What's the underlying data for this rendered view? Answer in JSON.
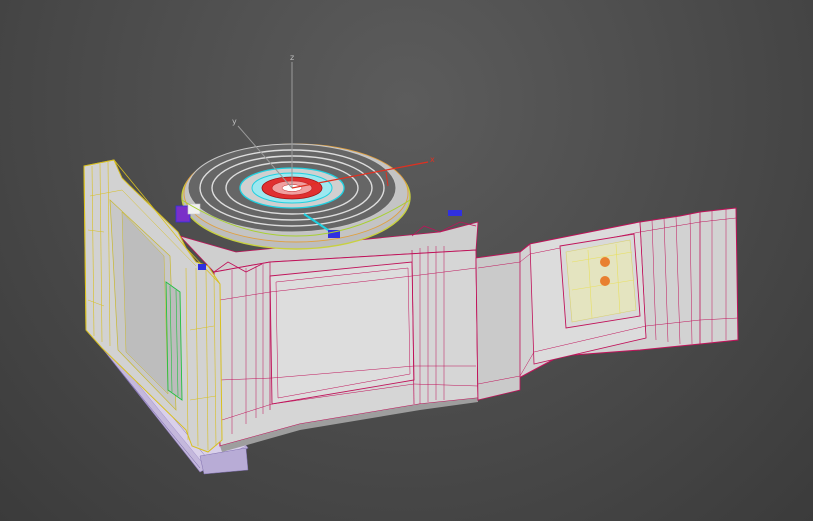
{
  "viewport": {
    "background": "#484848",
    "wire_colors": {
      "main_body": "#c0135a",
      "frame": "#d8c020",
      "ring": "#c8d040",
      "inner_ring": "#20d0e0",
      "center": "#e03030",
      "gizmo_x": "#e03020",
      "gizmo_y": "#9a9a9a",
      "gizmo_z": "#9a9a9a",
      "accent_green": "#20c040",
      "accent_blue": "#3030e0",
      "accent_orange": "#e88030",
      "base": "#a08cc8"
    }
  },
  "gizmo": {
    "x_label": "x",
    "y_label": "y",
    "z_label": "z"
  },
  "scene_objects": [
    {
      "id": "turntable",
      "name": "circular-platform"
    },
    {
      "id": "door-frame",
      "name": "door-frame"
    },
    {
      "id": "main-body",
      "name": "main-body"
    },
    {
      "id": "corridor",
      "name": "corridor-extension"
    },
    {
      "id": "window",
      "name": "window-panel"
    }
  ]
}
